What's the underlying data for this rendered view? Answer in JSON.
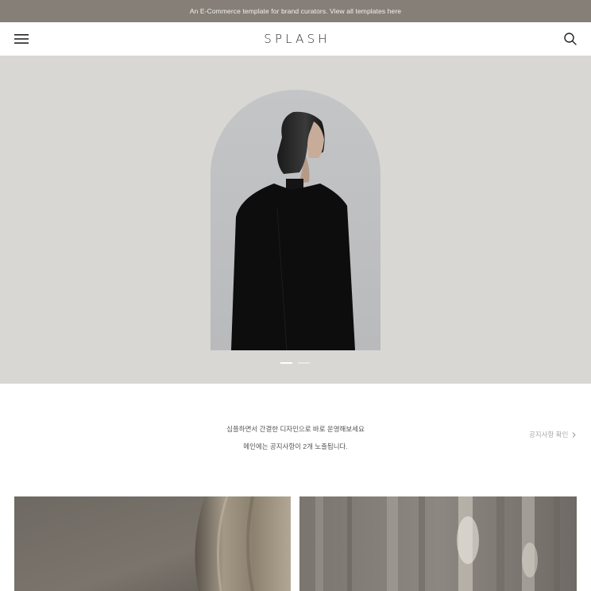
{
  "announcement": {
    "text": "An E-Commerce template for brand curators. View all templates here"
  },
  "header": {
    "logo": "SPLASH",
    "menu_icon": "hamburger-menu-icon",
    "search_icon": "search-icon"
  },
  "hero": {
    "slides_total": 2,
    "active_slide": 1
  },
  "notice": {
    "line1": "심플하면서 간결한 디자인으로 바로 운영해보세요",
    "line2": "메인에는 공지사항이 2개 노출됩니다.",
    "link_label": "공지사항 확인",
    "link_icon": "chevron-right-icon"
  },
  "colors": {
    "announcement_bg": "#857f77",
    "hero_bg": "#d8d7d4",
    "text_primary": "#2a2a2a",
    "text_muted": "#aaaaaa"
  }
}
